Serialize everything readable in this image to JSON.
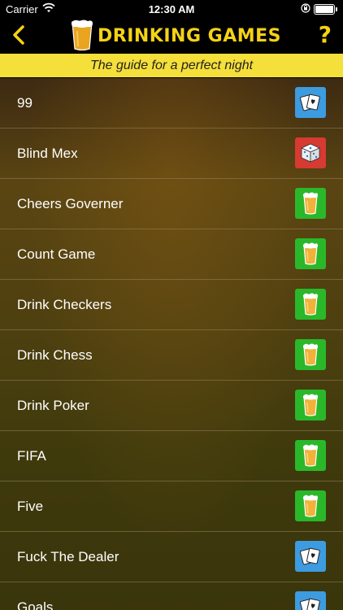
{
  "status_bar": {
    "carrier": "Carrier",
    "time": "12:30 AM",
    "wifi_icon": "wifi-icon",
    "battery_icon": "battery-icon",
    "lock_icon": "orientation-lock-icon"
  },
  "nav": {
    "back_icon": "chevron-left-icon",
    "logo_icon": "beer-glass-icon",
    "title": "DRINKING GAMES",
    "help_label": "?"
  },
  "subtitle": "The guide for a perfect night",
  "colors": {
    "accent_yellow": "#f5d215",
    "subtitle_bg": "#f5df3a",
    "cards_badge": "#3d9be0",
    "dice_badge": "#d63a31",
    "beer_badge": "#2ab82a"
  },
  "games": [
    {
      "name": "99",
      "icon": "cards-icon"
    },
    {
      "name": "Blind Mex",
      "icon": "dice-icon"
    },
    {
      "name": "Cheers Governer",
      "icon": "beer-icon"
    },
    {
      "name": "Count Game",
      "icon": "beer-icon"
    },
    {
      "name": "Drink Checkers",
      "icon": "beer-icon"
    },
    {
      "name": "Drink Chess",
      "icon": "beer-icon"
    },
    {
      "name": "Drink Poker",
      "icon": "beer-icon"
    },
    {
      "name": "FIFA",
      "icon": "beer-icon"
    },
    {
      "name": "Five",
      "icon": "beer-icon"
    },
    {
      "name": "Fuck The Dealer",
      "icon": "cards-icon"
    },
    {
      "name": "Goals",
      "icon": "cards-icon"
    }
  ]
}
